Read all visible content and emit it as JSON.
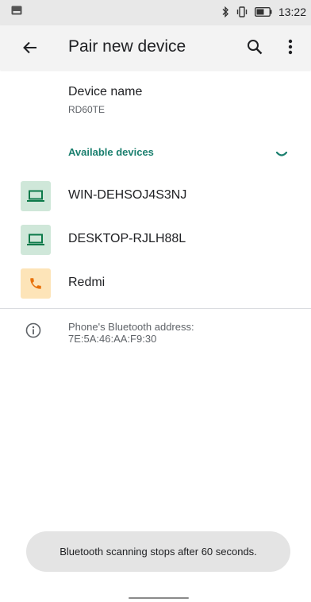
{
  "status_bar": {
    "time": "13:22",
    "left_icon": "image-icon",
    "icons": [
      "bluetooth-icon",
      "vibrate-icon",
      "battery-icon"
    ]
  },
  "app_bar": {
    "title": "Pair new device",
    "back_icon": "arrow-back-icon",
    "search_icon": "search-icon",
    "more_icon": "more-vert-icon"
  },
  "device_name": {
    "label": "Device name",
    "value": "RD60TE"
  },
  "available": {
    "header": "Available devices",
    "devices": [
      {
        "name": "WIN-DEHSOJ4S3NJ",
        "icon": "laptop-icon",
        "type": "computer"
      },
      {
        "name": "DESKTOP-RJLH88L",
        "icon": "laptop-icon",
        "type": "computer"
      },
      {
        "name": "Redmi",
        "icon": "phone-icon",
        "type": "phone"
      }
    ]
  },
  "info": {
    "icon": "info-icon",
    "text": "Phone's Bluetooth address: 7E:5A:46:AA:F9:30"
  },
  "toast": {
    "text": "Bluetooth scanning stops after 60 seconds."
  },
  "colors": {
    "accent": "#1a7f6e",
    "computer_icon_bg": "#cfe7d9",
    "computer_icon_fg": "#0d7a4a",
    "phone_icon_bg": "#fde4b8",
    "phone_icon_fg": "#e8710a"
  }
}
